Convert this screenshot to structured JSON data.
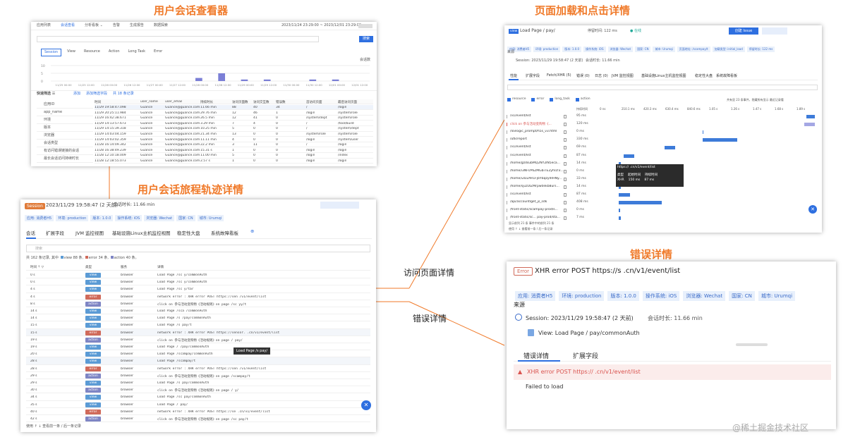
{
  "titles": {
    "session_viewer": "用户会话查看器",
    "page_load_click": "页面加载和点击详情",
    "journey_trace": "用户会话旅程轨迹详情",
    "error_detail": "错误详情"
  },
  "connectors": {
    "visit_page": "访问页面详情",
    "error_detail": "错误详情"
  },
  "watermark": "@稀土掘金技术社区",
  "viewer": {
    "nav": [
      "应用列表",
      "会话查看",
      "分析看板 ⌄",
      "告警",
      "生成报告",
      "数据探索"
    ],
    "timerange": "2023/11/24 23:29:00 ~ 2023/12/01 23:29:00",
    "tabs": [
      "Session",
      "View",
      "Resource",
      "Action",
      "Long Task",
      "Error"
    ],
    "search_button": "搜索",
    "chart_label": "会话数",
    "y_ticks": [
      "10",
      "5",
      "0"
    ],
    "x_ticks": [
      "11/25 00:00",
      "11/25 12:00",
      "11/26 00:00",
      "11/26 12:00",
      "11/27 00:00",
      "11/27 12:00",
      "11/28 00:00",
      "11/28 12:00",
      "11/29 00:00",
      "11/29 12:00",
      "11/30 00:00",
      "11/30 12:00",
      "12/01 00:00",
      "12/01 12:00"
    ],
    "filter_title": "快速筛选 ☰",
    "filter_actions": [
      "添加",
      "添加筛选字段",
      "共 18 条记录"
    ],
    "filters": [
      "应用ID",
      "app_name",
      "环境",
      "版本",
      "浏览器",
      "会话类型",
      "有访问错误链接的会话",
      "最长会话访问持续时长"
    ],
    "headers": [
      "时间",
      "user_name",
      "user_email",
      "持续时长",
      "访问页面数",
      "访问交互数",
      "错误数",
      "首访问页面",
      "最后访问页面"
    ],
    "rows": [
      [
        "11/29 19:58:47.098",
        "Guance",
        "Guance@guance.com",
        "11.66 min",
        "88",
        "40",
        "34",
        "/",
        "/login"
      ],
      [
        "11/29 20:25:11.984",
        "Guance",
        "Guance@guance.com",
        "29.76 min",
        "12",
        "46",
        "1",
        "/login",
        "/system/role"
      ],
      [
        "11/29 16:42:38.671",
        "Guance",
        "Guance@guance.com",
        "26.5 min",
        "12",
        "41",
        "0",
        "/system/dept",
        "/system/role"
      ],
      [
        "11/29 14:13:57.673",
        "Guance",
        "Guance@guance.com",
        "3.29 min",
        "7",
        "4",
        "0",
        "/",
        "/tool/build"
      ],
      [
        "11/29 14:15:39.318",
        "Guance",
        "Guance@guance.com",
        "10.25 min",
        "5",
        "0",
        "0",
        "/",
        "/system/dept"
      ],
      [
        "11/29 14:03:04.159",
        "Guance",
        "Guance@guance.com",
        "21.34 min",
        "13",
        "0",
        "0",
        "/system/role",
        "/system/role"
      ],
      [
        "11/29 14:03:02.359",
        "Guance",
        "Guance@guance.com",
        "11.11 min",
        "4",
        "0",
        "0",
        "/login",
        "/system/user"
      ],
      [
        "11/28 16:14:09.342",
        "Guance",
        "Guance@guance.com",
        "22.2 min",
        "3",
        "11",
        "0",
        "/",
        "/login"
      ],
      [
        "11/28 16:38:49.239",
        "Guance",
        "Guance@guance.com",
        "15.31 s",
        "1",
        "0",
        "0",
        "/login",
        "/login"
      ],
      [
        "11/28 12:10:18.009",
        "Guance",
        "Guance@guance.com",
        "11.00 min",
        "5",
        "0",
        "0",
        "/login",
        "/index"
      ],
      [
        "11/28 12:18:55.073",
        "Guance",
        "Guance@guance.com",
        "2.57 s",
        "1",
        "0",
        "0",
        "/login",
        "/login"
      ]
    ]
  },
  "journey": {
    "badge": "Session",
    "time": "2023/11/29 19:58:47 (2 天前)",
    "duration": "会话时长:  11.66 min",
    "tags": [
      "应用: 消费者H5",
      "环境: production",
      "版本: 1.0.0",
      "操作系统: iOS",
      "浏览器: Wechat",
      "国家: CN",
      "城市: Urumqi"
    ],
    "tabs": [
      "会话",
      "扩展字段",
      "JVM 监控视图",
      "基础设施Linux主机监控视图",
      "稳定性大盘",
      "系统故障看板"
    ],
    "search_placeholder": "搜索",
    "summary": "共 162 条记录, 其中",
    "summary_view": "view 88 条,",
    "summary_error": "error 34 条,",
    "summary_action": "action 40 条。",
    "headers": [
      "时间 ⇡ ▽",
      "类型",
      "服务",
      "详情"
    ],
    "rows": [
      {
        "t": "0 s",
        "type": "view",
        "svc": "browser",
        "detail": "Load Page /sc    y/commonAuth"
      },
      {
        "t": "0 s",
        "type": "view",
        "svc": "browser",
        "detail": "Load Page /sc    y/commonAuth"
      },
      {
        "t": "4 s",
        "type": "view",
        "svc": "browser",
        "detail": "Load Page /sc    y/tar"
      },
      {
        "t": "4 s",
        "type": "error",
        "svc": "browser",
        "detail": "network error : XHR error POST https://sen        /v1/event/list"
      },
      {
        "t": "8 s",
        "type": "action",
        "svc": "browser",
        "detail": "click on 参与活动变购物《活动规则》on page /sc    yy/t"
      },
      {
        "t": "14 s",
        "type": "view",
        "svc": "browser",
        "detail": "Load Page /sca   /commonAuth"
      },
      {
        "t": "14 s",
        "type": "view",
        "svc": "browser",
        "detail": "Load Page /s    /pay/commonAuth"
      },
      {
        "t": "15 s",
        "type": "view",
        "svc": "browser",
        "detail": "Load Page /s   pay/t"
      },
      {
        "t": "15 s",
        "type": "error",
        "svc": "browser",
        "detail": "network error : XHR error POST https://sensor.   .cn/v1/event/list"
      },
      {
        "t": "19 s",
        "type": "action",
        "svc": "browser",
        "detail": "click on 参与活动变购物《活动规则》on page /    pay/"
      },
      {
        "t": "19 s",
        "type": "view",
        "svc": "browser",
        "detail": "Load Page /      /pay/commonAuth"
      },
      {
        "t": "20 s",
        "type": "view",
        "svc": "browser",
        "detail": "Load Page /scampay/commonAuth"
      },
      {
        "t": "28 s",
        "type": "view",
        "svc": "browser",
        "detail": "Load Page /scampay/t"
      },
      {
        "t": "28 s",
        "type": "error",
        "svc": "browser",
        "detail": "network error : XHR error POST https://sen       /v1/event/list"
      },
      {
        "t": "29 s",
        "type": "action",
        "svc": "browser",
        "detail": "click on 参与活动变购物《活动规则》on page /scampay/t"
      },
      {
        "t": "29 s",
        "type": "view",
        "svc": "browser",
        "detail": "Load Page /s   pay/commonAuth"
      },
      {
        "t": "30 s",
        "type": "action",
        "svc": "browser",
        "detail": "click on 参与活动变购物《活动规则》on page /    y/"
      },
      {
        "t": "34 s",
        "type": "view",
        "svc": "browser",
        "detail": "Load Page /sc   pay/commonAuth"
      },
      {
        "t": "35 s",
        "type": "view",
        "svc": "browser",
        "detail": "Load Page /     pay/"
      },
      {
        "t": "40 s",
        "type": "error",
        "svc": "browser",
        "detail": "network error : XHR error POST https://se        .cn/v1/event/list"
      },
      {
        "t": "42 s",
        "type": "action",
        "svc": "browser",
        "detail": "click on 参与活动变购物《活动规则》on page /sc   pay/t"
      }
    ],
    "tooltip": "Load Page /s    pay/",
    "footer": "使用 ↑ ↓ 查看前一条 / 后一条记录"
  },
  "pageload": {
    "badge": "view",
    "title": "Load Page /      pay/",
    "stay": "停留时间:  122 ms",
    "status": "● 在线",
    "create_btn": "创建 Issue",
    "tags": [
      "应用: 消费者H5",
      "环境: production",
      "版本: 1.0.0",
      "操作系统: iOS",
      "浏览器: Wechat",
      "国家: CN",
      "城市: Urumqi",
      "页面地址: /scampay/t",
      "加载类型: initial_load",
      "停留时长: 122 ms"
    ],
    "source_label": "来源",
    "session": "Session:  2023/11/29 19:58:47 (2 天前)",
    "session_dur": "会话时长:  11.66 min",
    "tabs": [
      "性能",
      "扩展字段",
      "Fetch/XHR (5)",
      "错误 (0)",
      "日志 (0)",
      "JVM 监控视图",
      "基础设施Linux主机监控视图",
      "稳定性大盘",
      "系统故障看板"
    ],
    "checks": [
      "resource",
      "error",
      "long_task",
      "action"
    ],
    "checks_right": "共有显 23 条事件，隐藏所有显示  最近记录看",
    "col_dur": "持续时间",
    "axis": [
      "0 ns",
      "210.1 ms",
      "420.3 ms",
      "630.4 ms",
      "840.6 ms",
      "1.05 s",
      "1.26 s",
      "1.47 s",
      "1.68 s",
      "1.89 s"
    ],
    "rows": [
      {
        "name": "/v1/event/list",
        "dur": "95 ms",
        "start": 0.96,
        "w": 0.04
      },
      {
        "name": "click on 参与活动变购物《...",
        "dur": "120 ms",
        "start": 0.95,
        "w": 0.05,
        "action": true
      },
      {
        "name": "/lovlogic_prompt/h5s_v3.html",
        "dur": "0 ms",
        "start": 0.48,
        "w": 0.002
      },
      {
        "name": "/utk/report",
        "dur": "330 ms",
        "start": 0.48,
        "w": 0.16
      },
      {
        "name": "/v1/event/list",
        "dur": "69 ms",
        "start": 0.3,
        "w": 0.05
      },
      {
        "name": "/v1/event/list",
        "dur": "87 ms",
        "start": 0.11,
        "w": 0.05
      },
      {
        "name": "/home/gzdsubMQ2NY2lN5eca...",
        "dur": "14 ms",
        "start": 0.09,
        "w": 0.01
      },
      {
        "name": "/home/i3NFl/P6ZMGbiTE2yhI1f3...",
        "dur": "0 ms",
        "start": 0.09,
        "w": 0.004
      },
      {
        "name": "/home/i2D2AR1FjbYbqzyIHHNy...",
        "dur": "33 ms",
        "start": 0.09,
        "w": 0.015
      },
      {
        "name": "/home/sjuzUlZMrpw0ekb8urs...",
        "dur": "14 ms",
        "start": 0.09,
        "w": 0.01
      },
      {
        "name": "/v1/event/list",
        "dur": "87 ms",
        "start": 0.09,
        "w": 0.05
      },
      {
        "name": "/api/accountlget_js_sdk",
        "dur": "408 ms",
        "start": 0.09,
        "w": 0.2
      },
      {
        "name": "/front-static/scampay-prod/s...",
        "dur": "0 ms",
        "start": 0.09,
        "w": 0.004
      },
      {
        "name": "/front-static/sc... pay-prod/sta...",
        "dur": "7 ms",
        "start": 0.09,
        "w": 0.01
      }
    ],
    "tooltip_title": "https://          .cn/v1/event/list",
    "tooltip_headers": [
      "类型",
      "起始时间",
      "持续时间"
    ],
    "tooltip_values": [
      "XHR",
      "150 ms",
      "87 ms"
    ],
    "footer": "显示前列 21 条 事件中的前列 21 条",
    "footer2": "使用 ↑ ↓ 查看前一条 / 后一条记录"
  },
  "error": {
    "badge": "Error",
    "title": "XHR error POST https://s        .cn/v1/event/list",
    "tags": [
      "应用: 消费者H5",
      "环境: production",
      "版本: 1.0.0",
      "操作系统: iOS",
      "浏览器: Wechat",
      "国家: CN",
      "城市: Urumqi"
    ],
    "source_label": "来源",
    "session": "Session:  2023/11/29 19:58:47 (2 天前)",
    "session_dur": "会话时长:  11.66 min",
    "view": "View:  Load Page /        pay/commonAuth",
    "tabs": [
      "错误详情",
      "扩展字段"
    ],
    "error_line": "XHR error POST https://              .cn/v1/event/list",
    "message": "Failed to load"
  },
  "chart_data": {
    "type": "bar",
    "ylabel": "会话数",
    "ylim": [
      0,
      10
    ],
    "categories": [
      "11/25 00:00",
      "11/25 12:00",
      "11/26 00:00",
      "11/26 12:00",
      "11/27 00:00",
      "11/27 12:00",
      "11/28 00:00",
      "11/28 12:00",
      "11/29 00:00",
      "11/29 12:00",
      "11/30 00:00",
      "11/30 12:00",
      "12/01 00:00",
      "12/01 12:00"
    ],
    "values": [
      0,
      0,
      0,
      0,
      0,
      0,
      2,
      5,
      1,
      1,
      0,
      1,
      1,
      0
    ]
  }
}
